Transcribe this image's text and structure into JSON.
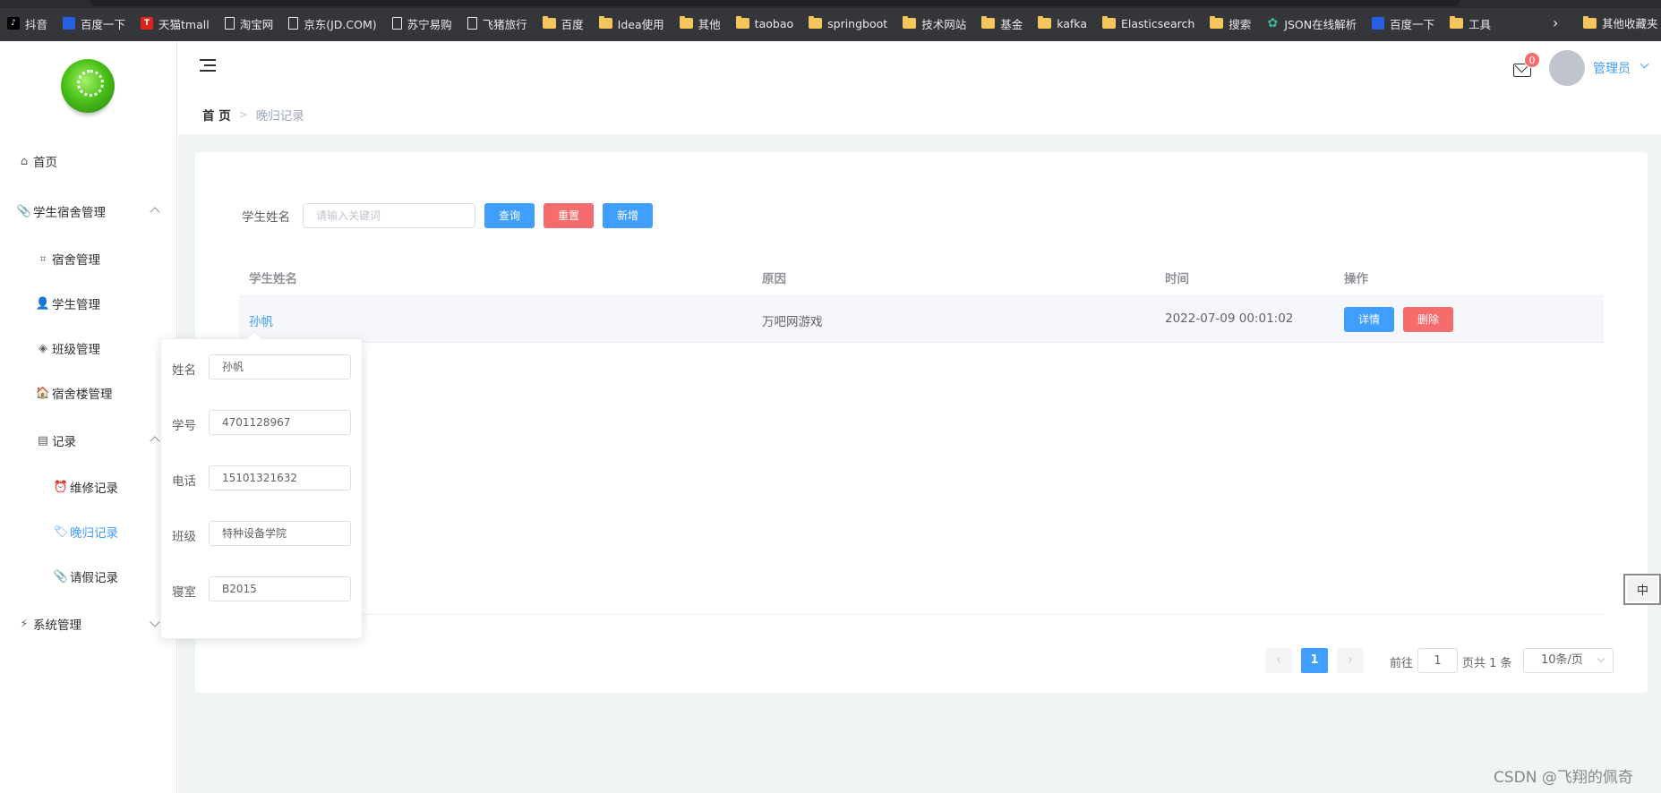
{
  "bookmarks": {
    "items": [
      {
        "label": "抖音",
        "icon": "tiktok-icon"
      },
      {
        "label": "百度一下",
        "icon": "baidu-icon"
      },
      {
        "label": "天猫tmall",
        "icon": "tmall-icon"
      },
      {
        "label": "淘宝网",
        "icon": "page-icon"
      },
      {
        "label": "京东(JD.COM)",
        "icon": "page-icon"
      },
      {
        "label": "苏宁易购",
        "icon": "page-icon"
      },
      {
        "label": "飞猪旅行",
        "icon": "page-icon"
      },
      {
        "label": "百度",
        "icon": "folder-icon"
      },
      {
        "label": "Idea使用",
        "icon": "folder-icon"
      },
      {
        "label": "其他",
        "icon": "folder-icon"
      },
      {
        "label": "taobao",
        "icon": "folder-icon"
      },
      {
        "label": "springboot",
        "icon": "folder-icon"
      },
      {
        "label": "技术网站",
        "icon": "folder-icon"
      },
      {
        "label": "基金",
        "icon": "folder-icon"
      },
      {
        "label": "kafka",
        "icon": "folder-icon"
      },
      {
        "label": "Elasticsearch",
        "icon": "folder-icon"
      },
      {
        "label": "搜索",
        "icon": "folder-icon"
      },
      {
        "label": "JSON在线解析",
        "icon": "gear-icon"
      },
      {
        "label": "百度一下",
        "icon": "baidu-icon"
      },
      {
        "label": "工具",
        "icon": "folder-icon"
      }
    ],
    "more": "›",
    "other": "其他收藏夹"
  },
  "sidebar": {
    "items": [
      {
        "label": "首页",
        "icon": "home-icon"
      },
      {
        "label": "学生宿舍管理",
        "icon": "paperclip-icon"
      },
      {
        "label": "宿舍管理",
        "icon": "crop-icon"
      },
      {
        "label": "学生管理",
        "icon": "user-icon"
      },
      {
        "label": "班级管理",
        "icon": "layers-icon"
      },
      {
        "label": "宿舍楼管理",
        "icon": "house-icon"
      },
      {
        "label": "记录",
        "icon": "document-icon"
      },
      {
        "label": "维修记录",
        "icon": "alarm-clock-icon"
      },
      {
        "label": "晚归记录",
        "icon": "tag-icon"
      },
      {
        "label": "请假记录",
        "icon": "paperclip-icon"
      },
      {
        "label": "系统管理",
        "icon": "lightning-icon"
      }
    ]
  },
  "header": {
    "breadcrumb_home": "首 页",
    "breadcrumb_sep": ">",
    "breadcrumb_current": "晚归记录",
    "badge_count": "0",
    "user_name": "管理员"
  },
  "search": {
    "label": "学生姓名",
    "placeholder": "请输入关键词",
    "query_button": "查询",
    "reset_button": "重置",
    "add_button": "新增"
  },
  "table": {
    "columns": [
      "学生姓名",
      "原因",
      "时间",
      "操作"
    ],
    "rows": [
      {
        "name": "孙帆",
        "reason": "万吧网游戏",
        "time": "2022-07-09 00:01:02",
        "detail_button": "详情",
        "delete_button": "删除"
      }
    ]
  },
  "pagination": {
    "prev": "‹",
    "page": "1",
    "next": "›",
    "goto_label": "前往",
    "goto_value": "1",
    "total_text": "页共 1 条",
    "page_size": "10条/页"
  },
  "popover": {
    "fields": [
      {
        "label": "姓名",
        "value": "孙帆"
      },
      {
        "label": "学号",
        "value": "4701128967"
      },
      {
        "label": "电话",
        "value": "15101321632"
      },
      {
        "label": "班级",
        "value": "特种设备学院"
      },
      {
        "label": "寝室",
        "value": "B2015"
      }
    ]
  },
  "ime": {
    "label": "中"
  },
  "watermark": "CSDN @飞翔的佩奇",
  "colors": {
    "primary": "#409eff",
    "danger": "#f56c6c",
    "main_bg": "#f0f4f5"
  }
}
